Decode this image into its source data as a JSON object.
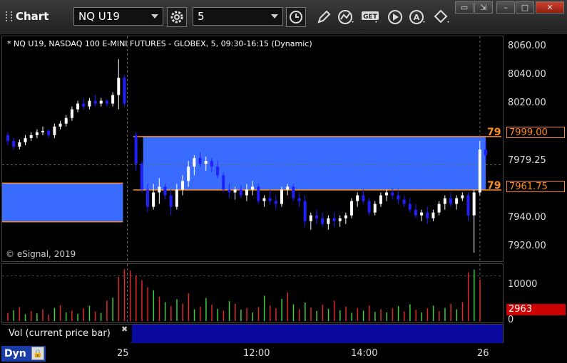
{
  "window": {
    "title": "Chart"
  },
  "toolbar": {
    "symbol": "NQ U19",
    "interval": "5",
    "icons": [
      "gear-icon",
      "clock-icon",
      "pencil-icon",
      "line-study-icon",
      "get-data-icon",
      "play-icon",
      "alert-icon",
      "move-icon"
    ]
  },
  "chart": {
    "header": "* NQ U19, NASDAQ 100 E-MINI FUTURES - GLOBEX, 5, 09:30-16:15 (Dynamic)",
    "copyright": "© eSignal, 2019",
    "yticks": [
      "8060.00",
      "8040.00",
      "8020.00",
      "7979.25",
      "7940.00",
      "7920.00"
    ],
    "upper_price": "7999.00",
    "lower_price": "7961.75",
    "upper_side_label": "79",
    "lower_side_label": "79",
    "vol_tick": "10000",
    "vol_zero": "0",
    "vol_current": "2963",
    "xticks": [
      "25",
      "12:00",
      "14:00",
      "26"
    ],
    "colors": {
      "up": "#ffffff",
      "down": "#2020ff",
      "zone": "#3a6bff",
      "level": "#ff8c1a",
      "vol_up": "#3ad13a",
      "vol_down": "#e02a2a"
    }
  },
  "chart_data": {
    "type": "candlestick",
    "ylim": [
      7915,
      8066
    ],
    "candles": [
      [
        8000,
        8002,
        7993,
        7996
      ],
      [
        7996,
        7998,
        7990,
        7992
      ],
      [
        7992,
        7997,
        7990,
        7995
      ],
      [
        7995,
        8000,
        7993,
        7998
      ],
      [
        7998,
        8002,
        7996,
        8000
      ],
      [
        8000,
        8004,
        7998,
        8002
      ],
      [
        8002,
        8006,
        8000,
        8003
      ],
      [
        8003,
        8004,
        7998,
        8000
      ],
      [
        8000,
        8008,
        7998,
        8006
      ],
      [
        8006,
        8010,
        8004,
        8008
      ],
      [
        8008,
        8014,
        8006,
        8012
      ],
      [
        8012,
        8020,
        8010,
        8018
      ],
      [
        8018,
        8024,
        8016,
        8022
      ],
      [
        8022,
        8026,
        8018,
        8020
      ],
      [
        8020,
        8026,
        8018,
        8024
      ],
      [
        8024,
        8028,
        8020,
        8022
      ],
      [
        8022,
        8026,
        8020,
        8024
      ],
      [
        8024,
        8025,
        8020,
        8022
      ],
      [
        8022,
        8030,
        8020,
        8028
      ],
      [
        8028,
        8053,
        8018,
        8040
      ],
      [
        8040,
        8042,
        8020,
        8022
      ],
      [
        8000,
        8002,
        7975,
        7980
      ],
      [
        7980,
        7982,
        7960,
        7962
      ],
      [
        7962,
        7966,
        7946,
        7950
      ],
      [
        7950,
        7966,
        7948,
        7960
      ],
      [
        7960,
        7970,
        7952,
        7964
      ],
      [
        7964,
        7966,
        7955,
        7958
      ],
      [
        7958,
        7962,
        7944,
        7950
      ],
      [
        7950,
        7966,
        7948,
        7962
      ],
      [
        7962,
        7972,
        7958,
        7968
      ],
      [
        7968,
        7982,
        7964,
        7978
      ],
      [
        7978,
        7986,
        7972,
        7984
      ],
      [
        7984,
        7988,
        7978,
        7980
      ],
      [
        7980,
        7985,
        7975,
        7982
      ],
      [
        7982,
        7984,
        7974,
        7978
      ],
      [
        7978,
        7982,
        7970,
        7972
      ],
      [
        7972,
        7974,
        7960,
        7962
      ],
      [
        7962,
        7966,
        7956,
        7960
      ],
      [
        7960,
        7964,
        7955,
        7962
      ],
      [
        7962,
        7965,
        7956,
        7958
      ],
      [
        7958,
        7966,
        7954,
        7962
      ],
      [
        7962,
        7968,
        7958,
        7964
      ],
      [
        7964,
        7966,
        7952,
        7954
      ],
      [
        7954,
        7958,
        7950,
        7956
      ],
      [
        7956,
        7962,
        7952,
        7954
      ],
      [
        7954,
        7958,
        7948,
        7952
      ],
      [
        7952,
        7964,
        7950,
        7962
      ],
      [
        7962,
        7966,
        7958,
        7964
      ],
      [
        7964,
        7966,
        7954,
        7956
      ],
      [
        7956,
        7960,
        7950,
        7954
      ],
      [
        7954,
        7958,
        7936,
        7940
      ],
      [
        7940,
        7946,
        7934,
        7944
      ],
      [
        7944,
        7948,
        7938,
        7942
      ],
      [
        7942,
        7946,
        7936,
        7938
      ],
      [
        7938,
        7944,
        7934,
        7942
      ],
      [
        7942,
        7946,
        7936,
        7940
      ],
      [
        7940,
        7944,
        7936,
        7942
      ],
      [
        7942,
        7946,
        7938,
        7944
      ],
      [
        7944,
        7956,
        7942,
        7954
      ],
      [
        7954,
        7960,
        7950,
        7958
      ],
      [
        7958,
        7962,
        7952,
        7954
      ],
      [
        7954,
        7956,
        7944,
        7946
      ],
      [
        7946,
        7954,
        7944,
        7952
      ],
      [
        7952,
        7960,
        7950,
        7958
      ],
      [
        7958,
        7962,
        7954,
        7960
      ],
      [
        7960,
        7963,
        7955,
        7958
      ],
      [
        7958,
        7962,
        7952,
        7955
      ],
      [
        7955,
        7958,
        7950,
        7952
      ],
      [
        7952,
        7956,
        7946,
        7948
      ],
      [
        7948,
        7952,
        7942,
        7944
      ],
      [
        7944,
        7948,
        7940,
        7946
      ],
      [
        7946,
        7950,
        7938,
        7942
      ],
      [
        7942,
        7948,
        7940,
        7946
      ],
      [
        7946,
        7954,
        7944,
        7952
      ],
      [
        7952,
        7958,
        7948,
        7956
      ],
      [
        7956,
        7960,
        7950,
        7952
      ],
      [
        7952,
        7958,
        7948,
        7956
      ],
      [
        7956,
        7960,
        7954,
        7958
      ],
      [
        7958,
        7960,
        7940,
        7944
      ],
      [
        7944,
        7962,
        7918,
        7960
      ],
      [
        7960,
        7996,
        7958,
        7990
      ],
      [
        7990,
        7996,
        7982,
        7986
      ]
    ],
    "zone_prev": {
      "top": 7966.5,
      "bottom": 7939.5
    },
    "zone_main": {
      "top": 7999.0,
      "bottom": 7961.75
    },
    "volume": [
      [
        1800,
        0
      ],
      [
        2400,
        1
      ],
      [
        3100,
        0
      ],
      [
        1500,
        1
      ],
      [
        2200,
        0
      ],
      [
        1700,
        1
      ],
      [
        2600,
        0
      ],
      [
        1400,
        0
      ],
      [
        2900,
        1
      ],
      [
        3500,
        0
      ],
      [
        1900,
        1
      ],
      [
        2300,
        0
      ],
      [
        1600,
        1
      ],
      [
        2800,
        0
      ],
      [
        3400,
        1
      ],
      [
        2100,
        0
      ],
      [
        1800,
        1
      ],
      [
        4500,
        0
      ],
      [
        5200,
        1
      ],
      [
        9800,
        0
      ],
      [
        11500,
        0
      ],
      [
        11200,
        0
      ],
      [
        10100,
        0
      ],
      [
        9000,
        0
      ],
      [
        7500,
        0
      ],
      [
        6800,
        1
      ],
      [
        5400,
        0
      ],
      [
        4200,
        1
      ],
      [
        3300,
        0
      ],
      [
        4800,
        1
      ],
      [
        3900,
        0
      ],
      [
        6100,
        0
      ],
      [
        2600,
        1
      ],
      [
        3200,
        0
      ],
      [
        5100,
        1
      ],
      [
        3600,
        0
      ],
      [
        2700,
        1
      ],
      [
        2300,
        0
      ],
      [
        4400,
        1
      ],
      [
        3800,
        0
      ],
      [
        2500,
        1
      ],
      [
        2900,
        0
      ],
      [
        1900,
        1
      ],
      [
        3100,
        0
      ],
      [
        5600,
        1
      ],
      [
        3400,
        0
      ],
      [
        2800,
        0
      ],
      [
        4900,
        1
      ],
      [
        6300,
        0
      ],
      [
        3700,
        1
      ],
      [
        2600,
        0
      ],
      [
        4100,
        1
      ],
      [
        3000,
        0
      ],
      [
        2200,
        1
      ],
      [
        3600,
        0
      ],
      [
        2700,
        1
      ],
      [
        4500,
        0
      ],
      [
        2400,
        1
      ],
      [
        3200,
        0
      ],
      [
        1800,
        1
      ],
      [
        2900,
        0
      ],
      [
        2300,
        1
      ],
      [
        3400,
        0
      ],
      [
        2000,
        1
      ],
      [
        2600,
        0
      ],
      [
        1900,
        1
      ],
      [
        2800,
        0
      ],
      [
        3300,
        1
      ],
      [
        2100,
        0
      ],
      [
        3700,
        1
      ],
      [
        2500,
        0
      ],
      [
        1900,
        1
      ],
      [
        2800,
        0
      ],
      [
        3400,
        1
      ],
      [
        2200,
        0
      ],
      [
        2900,
        1
      ],
      [
        3800,
        0
      ],
      [
        2600,
        1
      ],
      [
        4200,
        0
      ],
      [
        10800,
        0
      ],
      [
        11400,
        1
      ],
      [
        9200,
        0
      ]
    ],
    "vol_ylim": [
      0,
      12000
    ]
  }
}
